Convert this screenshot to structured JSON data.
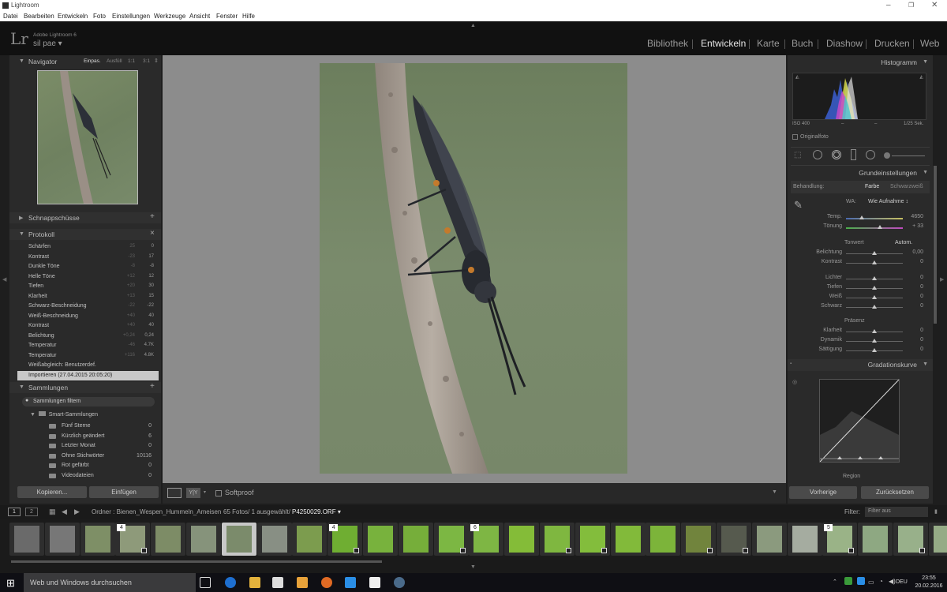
{
  "window": {
    "title": "Lightroom",
    "controls": [
      "–",
      "❐",
      "✕"
    ]
  },
  "menu": [
    "Datei",
    "Bearbeiten",
    "Entwickeln",
    "Foto",
    "Einstellungen",
    "Werkzeuge",
    "Ansicht",
    "Fenster",
    "Hilfe"
  ],
  "identity": {
    "logo": "Lr",
    "app": "Adobe Lightroom 6",
    "user": "sil pae"
  },
  "modules": [
    "Bibliothek",
    "Entwickeln",
    "Karte",
    "Buch",
    "Diashow",
    "Drucken",
    "Web"
  ],
  "active_module": "Entwickeln",
  "navigator": {
    "title": "Navigator",
    "zoom": [
      "Einpas.",
      "Ausfüll",
      "1:1",
      "3:1"
    ]
  },
  "snapshots": {
    "title": "Schnappschüsse",
    "add": "+"
  },
  "history": {
    "title": "Protokoll",
    "close": "×",
    "rows": [
      {
        "name": "Schärfen",
        "a": "25",
        "b": "0"
      },
      {
        "name": "Kontrast",
        "a": "-23",
        "b": "17"
      },
      {
        "name": "Dunkle Töne",
        "a": "-8",
        "b": "-8"
      },
      {
        "name": "Helle Töne",
        "a": "+12",
        "b": "12"
      },
      {
        "name": "Tiefen",
        "a": "+20",
        "b": "30"
      },
      {
        "name": "Klarheit",
        "a": "+13",
        "b": "15"
      },
      {
        "name": "Schwarz-Beschneidung",
        "a": "-22",
        "b": "-22"
      },
      {
        "name": "Weiß-Beschneidung",
        "a": "+40",
        "b": "40"
      },
      {
        "name": "Kontrast",
        "a": "+40",
        "b": "40"
      },
      {
        "name": "Belichtung",
        "a": "+0,24",
        "b": "0,24"
      },
      {
        "name": "Temperatur",
        "a": "-46",
        "b": "4.7K"
      },
      {
        "name": "Temperatur",
        "a": "+116",
        "b": "4.8K"
      },
      {
        "name": "Weißabgleich: Benutzerdef.",
        "a": "",
        "b": ""
      },
      {
        "name": "Importieren (27.04.2015 20:05:20)",
        "a": "",
        "b": ""
      }
    ]
  },
  "collections": {
    "title": "Sammlungen",
    "add": "+",
    "filter": "Sammlungen filtern",
    "group": "Smart-Sammlungen",
    "items": [
      {
        "name": "Fünf Sterne",
        "count": "0"
      },
      {
        "name": "Kürzlich geändert",
        "count": "6"
      },
      {
        "name": "Letzter Monat",
        "count": "0"
      },
      {
        "name": "Ohne Stichwörter",
        "count": "10116"
      },
      {
        "name": "Rot gefärbt",
        "count": "0"
      },
      {
        "name": "Videodateien",
        "count": "0"
      }
    ]
  },
  "left_buttons": {
    "copy": "Kopieren...",
    "paste": "Einfügen"
  },
  "toolbar": {
    "softproof": "Softproof",
    "yy": "Y|Y"
  },
  "right": {
    "histogram": {
      "title": "Histogramm",
      "iso": "ISO 400",
      "mid1": "–",
      "mid2": "–",
      "shutter": "1/25 Sek.",
      "original": "Originalfoto"
    },
    "basic": {
      "title": "Grundeinstellungen",
      "treatment_label": "Behandlung:",
      "treat_color": "Farbe",
      "treat_bw": "Schwarzweiß",
      "wb_label": "WA:",
      "wb_value": "Wie Aufnahme ↕",
      "tone_label": "Tonwert",
      "auto": "Autom.",
      "presence": "Präsenz",
      "sliders_wb": [
        {
          "name": "Temp.",
          "val": "4650",
          "pos": 0.28
        },
        {
          "name": "Tönung",
          "val": "+ 33",
          "pos": 0.6
        }
      ],
      "sliders_tone": [
        {
          "name": "Belichtung",
          "val": "0,00",
          "pos": 0.5
        },
        {
          "name": "Kontrast",
          "val": "0",
          "pos": 0.5
        }
      ],
      "sliders_tone2": [
        {
          "name": "Lichter",
          "val": "0",
          "pos": 0.5
        },
        {
          "name": "Tiefen",
          "val": "0",
          "pos": 0.5
        },
        {
          "name": "Weiß",
          "val": "0",
          "pos": 0.5
        },
        {
          "name": "Schwarz",
          "val": "0",
          "pos": 0.5
        }
      ],
      "sliders_presence": [
        {
          "name": "Klarheit",
          "val": "0",
          "pos": 0.5
        },
        {
          "name": "Dynamik",
          "val": "0",
          "pos": 0.5
        },
        {
          "name": "Sättigung",
          "val": "0",
          "pos": 0.5
        }
      ]
    },
    "curve": {
      "title": "Gradationskurve",
      "region": "Region"
    },
    "buttons": {
      "prev": "Vorherige",
      "reset": "Zurücksetzen"
    }
  },
  "filmstrip": {
    "view1": "1",
    "view2": "2",
    "path": "Ordner : Bienen_Wespen_Hummeln_Ameisen",
    "count": "65 Fotos/ 1 ausgewählt/",
    "file": "P4250029.ORF",
    "filter_label": "Filter:",
    "filter_value": "Filter aus"
  },
  "thumbs": [
    {
      "badge": "",
      "mark": false,
      "tone": "#6a6a6a"
    },
    {
      "badge": "",
      "mark": false,
      "tone": "#777"
    },
    {
      "badge": "",
      "mark": false,
      "tone": "#7e8f66"
    },
    {
      "badge": "4",
      "mark": true,
      "tone": "#8e9a7a"
    },
    {
      "badge": "",
      "mark": false,
      "tone": "#7d8c66"
    },
    {
      "badge": "",
      "mark": false,
      "tone": "#86937b"
    },
    {
      "badge": "",
      "mark": false,
      "tone": "#7b8b6b"
    },
    {
      "badge": "",
      "mark": false,
      "tone": "#888f84"
    },
    {
      "badge": "",
      "mark": false,
      "tone": "#7c9c4e"
    },
    {
      "badge": "4",
      "mark": true,
      "tone": "#6fae32"
    },
    {
      "badge": "",
      "mark": false,
      "tone": "#78b23d"
    },
    {
      "badge": "",
      "mark": false,
      "tone": "#76ae3a"
    },
    {
      "badge": "",
      "mark": true,
      "tone": "#7cb743"
    },
    {
      "badge": "6",
      "mark": false,
      "tone": "#7eb644"
    },
    {
      "badge": "",
      "mark": false,
      "tone": "#84bc38"
    },
    {
      "badge": "",
      "mark": true,
      "tone": "#7fb740"
    },
    {
      "badge": "",
      "mark": true,
      "tone": "#83bd3c"
    },
    {
      "badge": "",
      "mark": false,
      "tone": "#82ba3a"
    },
    {
      "badge": "",
      "mark": false,
      "tone": "#7cb43a"
    },
    {
      "badge": "",
      "mark": true,
      "tone": "#71843d"
    },
    {
      "badge": "",
      "mark": true,
      "tone": "#565a4e"
    },
    {
      "badge": "",
      "mark": false,
      "tone": "#8b9a7e"
    },
    {
      "badge": "",
      "mark": false,
      "tone": "#a5aca0"
    },
    {
      "badge": "5",
      "mark": true,
      "tone": "#9ab387"
    },
    {
      "badge": "",
      "mark": false,
      "tone": "#8ea882"
    },
    {
      "badge": "",
      "mark": true,
      "tone": "#98b08a"
    },
    {
      "badge": "",
      "mark": false,
      "tone": "#95ab86"
    }
  ],
  "taskbar": {
    "search": "Web und Windows durchsuchen",
    "lang": "DEU",
    "time": "23:55",
    "date": "20.02.2016"
  }
}
